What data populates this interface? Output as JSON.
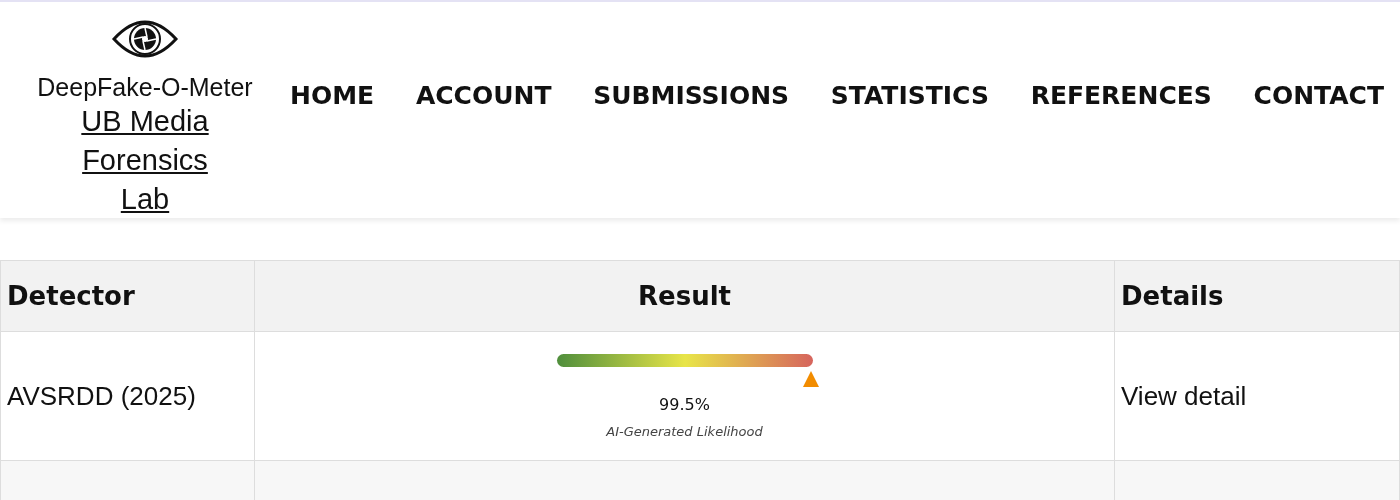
{
  "brand": {
    "name": "DeepFake-O-Meter",
    "lab_link": "UB Media Forensics Lab"
  },
  "nav": [
    "HOME",
    "ACCOUNT",
    "SUBMISSIONS",
    "STATISTICS",
    "REFERENCES",
    "CONTACT"
  ],
  "table": {
    "columns": [
      "Detector",
      "Result",
      "Details"
    ],
    "rows": [
      {
        "detector": "AVSRDD (2025)",
        "level": 0.995,
        "reading": "99.5%",
        "caption": "AI-Generated Likelihood",
        "details_link": "View detail"
      }
    ]
  }
}
